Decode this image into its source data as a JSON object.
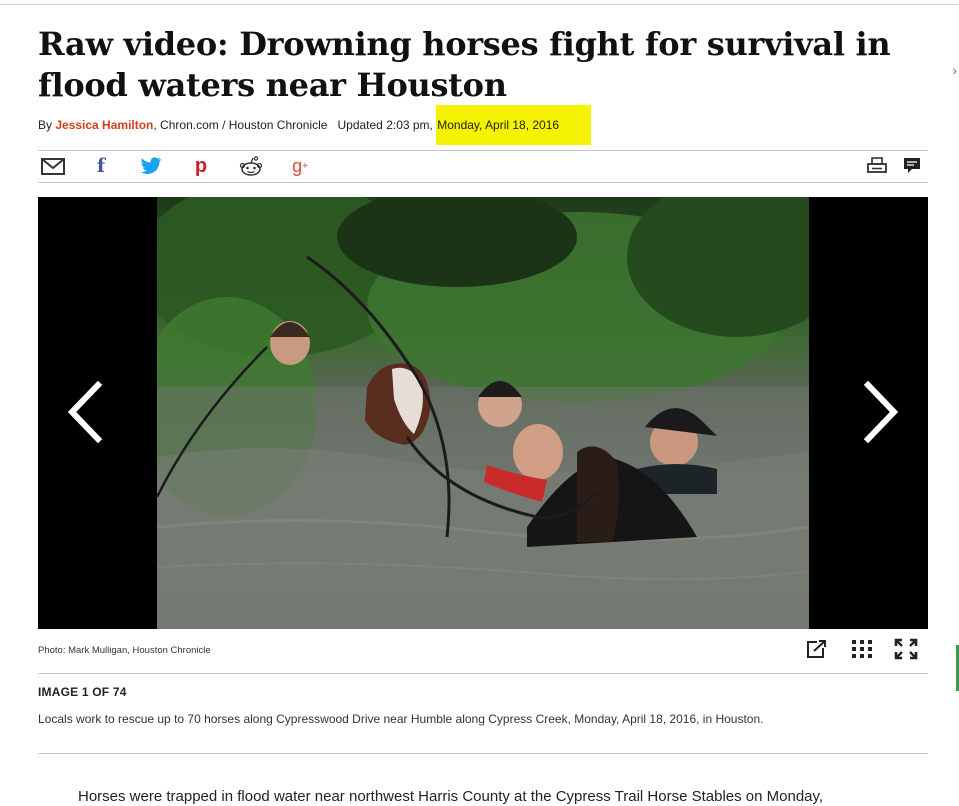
{
  "headline": "Raw video: Drowning horses fight for survival in flood waters near Houston",
  "byline": {
    "by": "By ",
    "author": "Jessica Hamilton",
    "outlets": ", Chron.com / Houston Chronicle",
    "updated": "Updated 2:03 pm, ",
    "date": "Monday, April 18, 2016"
  },
  "share": {
    "icons": [
      "email-icon",
      "facebook-icon",
      "twitter-icon",
      "pinterest-icon",
      "reddit-icon",
      "google-plus-icon",
      "print-icon",
      "comment-icon"
    ],
    "facebook_glyph": "f",
    "pinterest_glyph": "p",
    "google_plus_glyph": "g",
    "google_plus_sup": "+"
  },
  "gallery": {
    "photo_credit": "Photo: Mark Mulligan, Houston Chronicle",
    "image_counter": "IMAGE 1 OF 74",
    "caption": "Locals work to rescue up to 70 horses along Cypresswood Drive near Humble along Cypress Creek, Monday, April 18, 2016, in Houston.",
    "controls": [
      "external-link-icon",
      "grid-icon",
      "fullscreen-icon"
    ]
  },
  "article": {
    "first_line": "Horses were trapped in flood water near northwest Harris County at the Cypress Trail Horse Stables on Monday,"
  },
  "colors": {
    "author": "#d1401f",
    "highlight": "#f5f200",
    "twitter": "#1da1f2",
    "facebook": "#3b5998",
    "pinterest": "#cb2027",
    "google_plus": "#dd4b39"
  }
}
